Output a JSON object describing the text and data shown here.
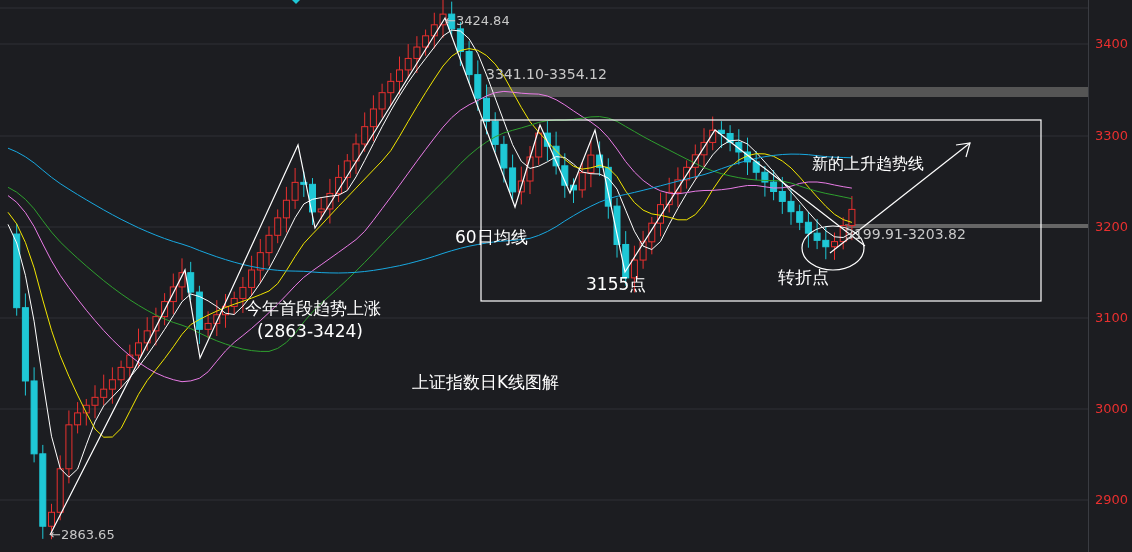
{
  "chart": {
    "title": "上证指数日K线图解",
    "y_axis_labels": [
      "3400",
      "3300",
      "3200",
      "3100",
      "3000",
      "2900"
    ],
    "annotations": [
      {
        "kind": "price",
        "text": "←3424.84"
      },
      {
        "kind": "price",
        "text": "3341.10-3354.12"
      },
      {
        "kind": "note",
        "text": "60日均线"
      },
      {
        "kind": "note",
        "text": "3155点"
      },
      {
        "kind": "note",
        "text": "转折点"
      },
      {
        "kind": "note",
        "text": "新的上升趋势线"
      },
      {
        "kind": "price",
        "text": "3199.91-3203.82"
      },
      {
        "kind": "note",
        "text": "今年首段趋势上涨"
      },
      {
        "kind": "note",
        "text": "(2863-3424)"
      },
      {
        "kind": "price",
        "text": "←2863.65"
      }
    ]
  }
}
